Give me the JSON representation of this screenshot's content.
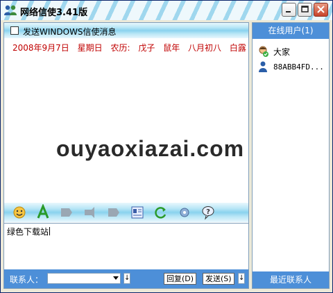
{
  "window": {
    "title": "网络信使3.41版"
  },
  "options": {
    "send_windows_label": "发送WINDOWS信使消息"
  },
  "history": {
    "date": "2008年9月7日",
    "weekday": "星期日",
    "lunar_label": "农历:",
    "lunar_year": "戊子",
    "zodiac": "鼠年",
    "lunar_day": "八月初八",
    "solar_term": "白露"
  },
  "toolbar": {
    "tools": [
      "smile-icon",
      "font-icon",
      "tool-3-icon",
      "tool-4-icon",
      "tool-5-icon",
      "contact-card-icon",
      "refresh-icon",
      "settings-icon",
      "help-icon"
    ]
  },
  "compose": {
    "text": "绿色下载站"
  },
  "footer": {
    "contact_label": "联系人：",
    "contact_value": "",
    "down_arrow": "↓",
    "reply_label": "回复(D)",
    "send_label": "发送(S)"
  },
  "online": {
    "header": "在线用户(1)",
    "users": [
      {
        "name": "大家",
        "icon": "group-icon"
      },
      {
        "name": "88ABB4FD...",
        "icon": "user-icon"
      }
    ],
    "recent_label": "最近联系人"
  },
  "watermark": {
    "text": "ouyaoxiazai.com"
  },
  "colors": {
    "accent_blue": "#4d8fd8",
    "date_red": "#c00000",
    "title_stripe": "#9fd7ee"
  }
}
